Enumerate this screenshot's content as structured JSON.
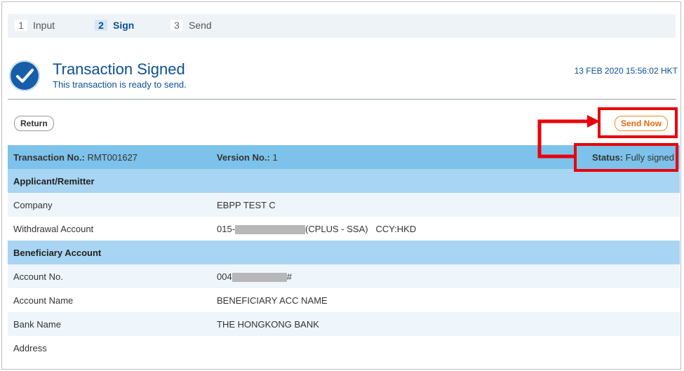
{
  "steps": [
    {
      "num": "1",
      "label": "Input"
    },
    {
      "num": "2",
      "label": "Sign"
    },
    {
      "num": "3",
      "label": "Send"
    }
  ],
  "status_header": {
    "title": "Transaction Signed",
    "subtitle": "This transaction is ready to send.",
    "timestamp": "13 FEB 2020 15:56:02 HKT"
  },
  "actions": {
    "return_label": "Return",
    "send_label": "Send Now"
  },
  "summary": {
    "transaction_label": "Transaction No.:",
    "transaction_value": "RMT001627",
    "version_label": "Version No.:",
    "version_value": "1",
    "status_label": "Status:",
    "status_value": "Fully signed"
  },
  "sections": {
    "applicant_title": "Applicant/Remitter",
    "beneficiary_title": "Beneficiary Account"
  },
  "rows": {
    "company": {
      "label": "Company",
      "value": "EBPP TEST C"
    },
    "withdrawal": {
      "label": "Withdrawal Account",
      "prefix": "015-",
      "suffix": "(CPLUS - SSA)   CCY:HKD"
    },
    "account_no": {
      "label": "Account No.",
      "prefix": "004",
      "suffix": "#"
    },
    "account_name": {
      "label": "Account Name",
      "value": "BENEFICIARY ACC NAME"
    },
    "bank_name": {
      "label": "Bank Name",
      "value": "THE HONGKONG BANK"
    },
    "address": {
      "label": "Address",
      "value": ""
    }
  },
  "colors": {
    "accent": "#0b4f96",
    "highlight": "#e8000b",
    "send": "#e8680a"
  },
  "icons": {
    "status": "check-circle-icon"
  }
}
